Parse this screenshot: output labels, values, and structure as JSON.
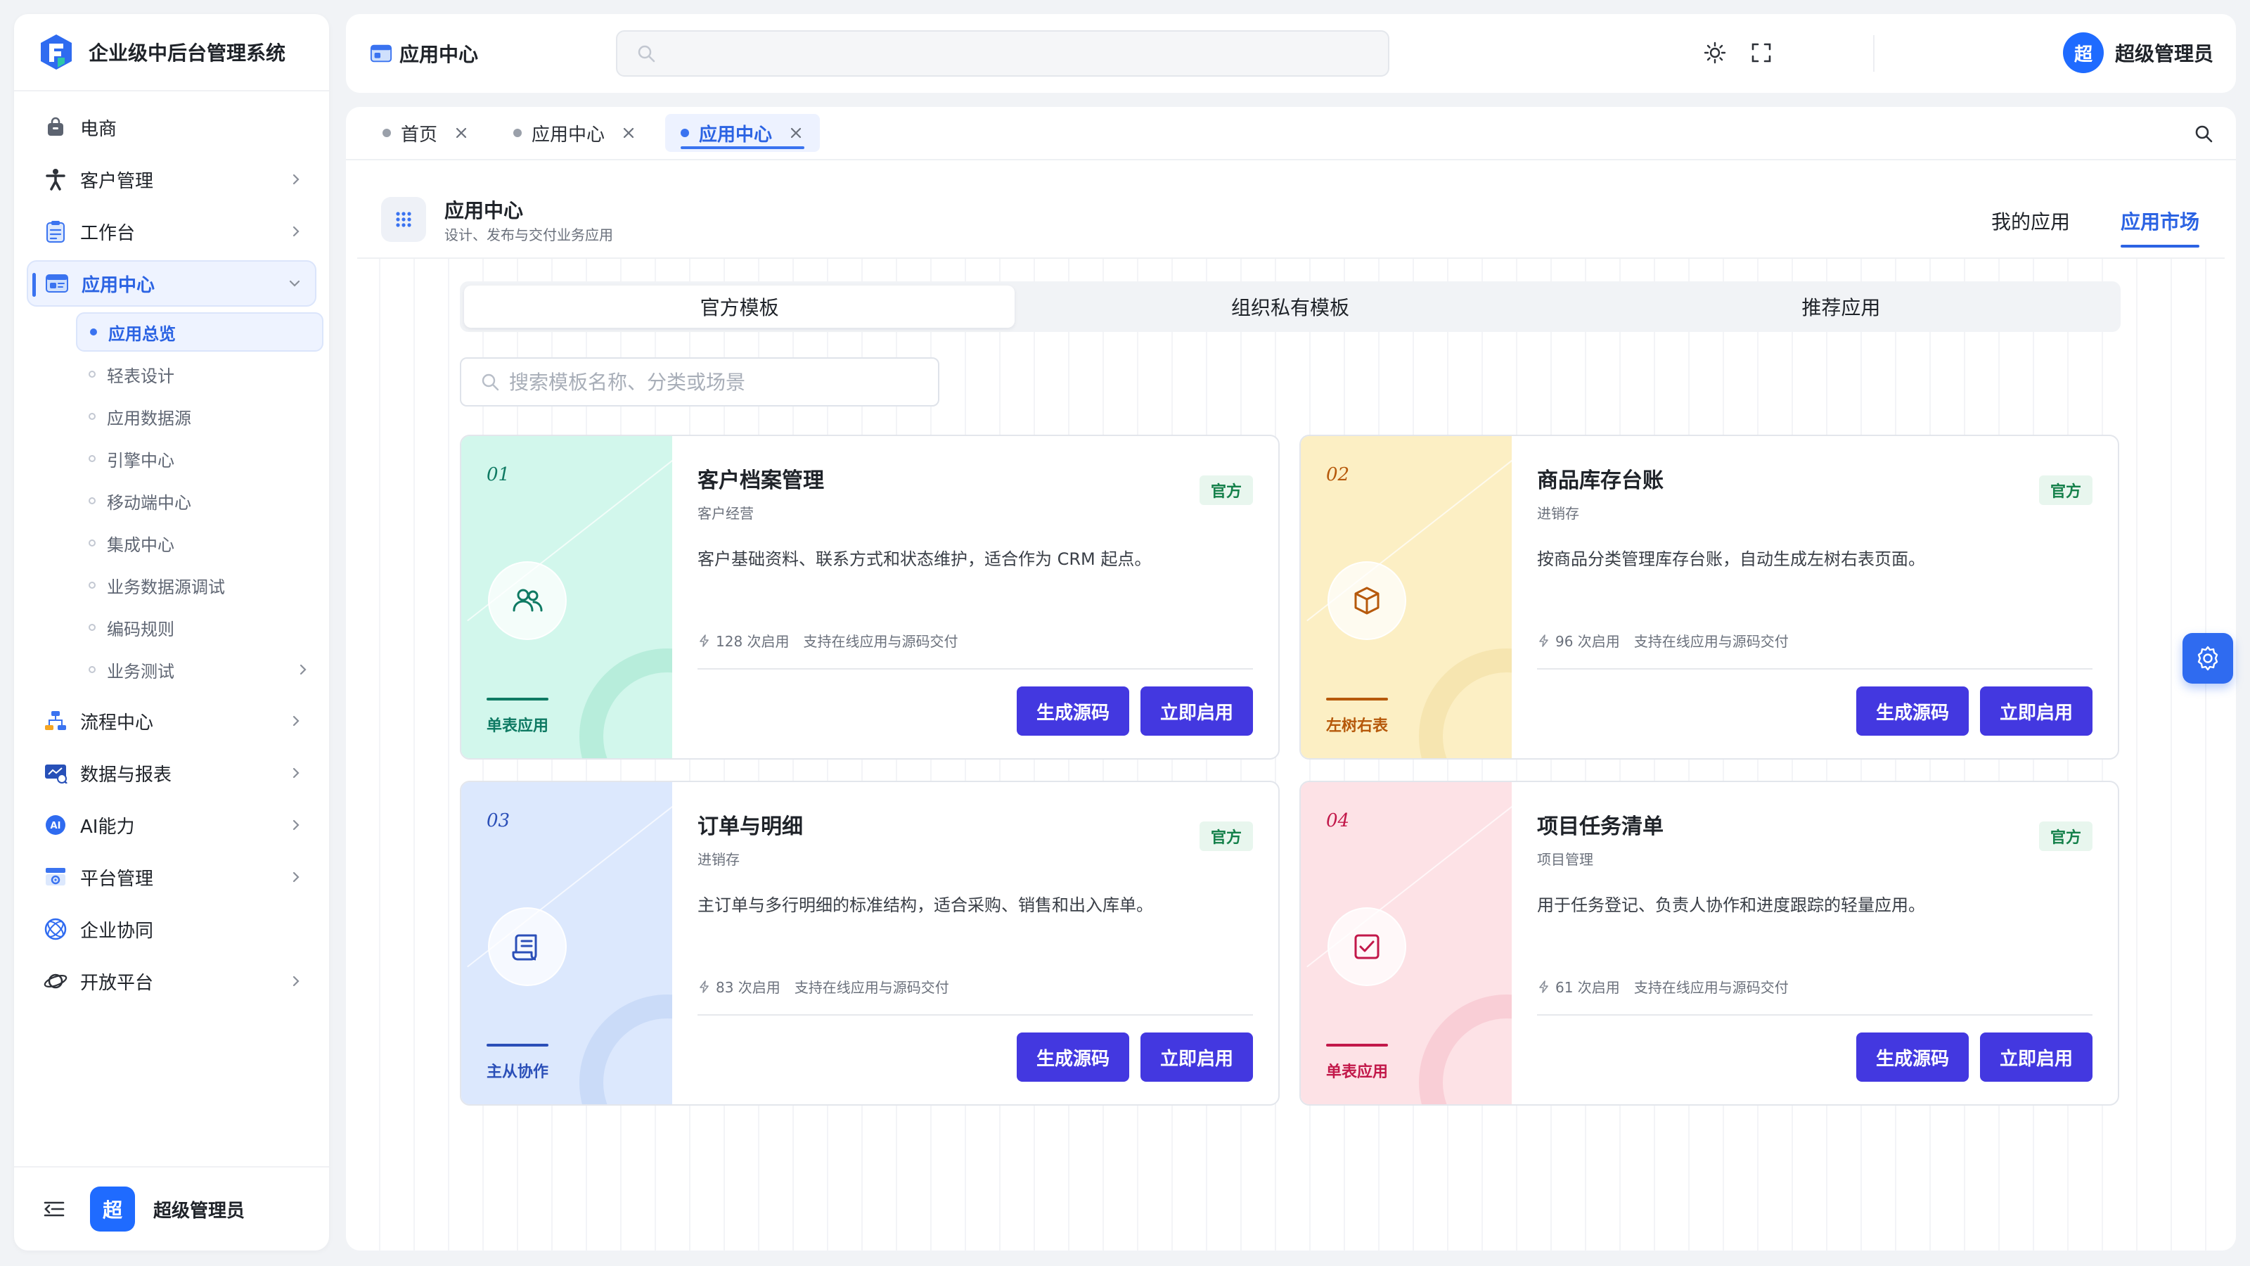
{
  "sidebar": {
    "brand_title": "企业级中后台管理系统",
    "nav": [
      {
        "label": "电商"
      },
      {
        "label": "客户管理"
      },
      {
        "label": "工作台"
      },
      {
        "label": "应用中心"
      },
      {
        "label": "流程中心"
      },
      {
        "label": "数据与报表"
      },
      {
        "label": "AI能力"
      },
      {
        "label": "平台管理"
      },
      {
        "label": "企业协同"
      },
      {
        "label": "开放平台"
      }
    ],
    "subnav": [
      {
        "label": "应用总览"
      },
      {
        "label": "轻表设计"
      },
      {
        "label": "应用数据源"
      },
      {
        "label": "引擎中心"
      },
      {
        "label": "移动端中心"
      },
      {
        "label": "集成中心"
      },
      {
        "label": "业务数据源调试"
      },
      {
        "label": "编码规则"
      },
      {
        "label": "业务测试"
      }
    ],
    "footer": {
      "avatar_text": "超",
      "user_name": "超级管理员"
    }
  },
  "header": {
    "title": "应用中心",
    "search_placeholder": "",
    "user": {
      "avatar_text": "超",
      "name": "超级管理员"
    }
  },
  "tabs": [
    {
      "label": "首页"
    },
    {
      "label": "应用中心"
    },
    {
      "label": "应用中心"
    }
  ],
  "page": {
    "title": "应用中心",
    "subtitle": "设计、发布与交付业务应用",
    "tabs": [
      {
        "label": "我的应用"
      },
      {
        "label": "应用市场"
      }
    ]
  },
  "segments": [
    {
      "label": "官方模板"
    },
    {
      "label": "组织私有模板"
    },
    {
      "label": "推荐应用"
    }
  ],
  "template_search": {
    "placeholder": "搜索模板名称、分类或场景"
  },
  "cards": [
    {
      "num": "01",
      "kind": "单表应用",
      "title": "客户档案管理",
      "category": "客户经营",
      "badge": "官方",
      "desc": "客户基础资料、联系方式和状态维护，适合作为 CRM 起点。",
      "usage": "128 次启用",
      "feature": "支持在线应用与源码交付",
      "btn_generate": "生成源码",
      "btn_enable": "立即启用",
      "bg": "#d2f7ec",
      "accent": "#0f7a63",
      "icon": "users-icon"
    },
    {
      "num": "02",
      "kind": "左树右表",
      "title": "商品库存台账",
      "category": "进销存",
      "badge": "官方",
      "desc": "按商品分类管理库存台账，自动生成左树右表页面。",
      "usage": "96 次启用",
      "feature": "支持在线应用与源码交付",
      "btn_generate": "生成源码",
      "btn_enable": "立即启用",
      "bg": "#fcefc4",
      "accent": "#b6590b",
      "icon": "box-icon"
    },
    {
      "num": "03",
      "kind": "主从协作",
      "title": "订单与明细",
      "category": "进销存",
      "badge": "官方",
      "desc": "主订单与多行明细的标准结构，适合采购、销售和出入库单。",
      "usage": "83 次启用",
      "feature": "支持在线应用与源码交付",
      "btn_generate": "生成源码",
      "btn_enable": "立即启用",
      "bg": "#dce8fd",
      "accent": "#2b4fb8",
      "icon": "receipt-icon"
    },
    {
      "num": "04",
      "kind": "单表应用",
      "title": "项目任务清单",
      "category": "项目管理",
      "badge": "官方",
      "desc": "用于任务登记、负责人协作和进度跟踪的轻量应用。",
      "usage": "61 次启用",
      "feature": "支持在线应用与源码交付",
      "btn_generate": "生成源码",
      "btn_enable": "立即启用",
      "bg": "#fde2e6",
      "accent": "#c2184a",
      "icon": "checkbox-icon"
    }
  ]
}
